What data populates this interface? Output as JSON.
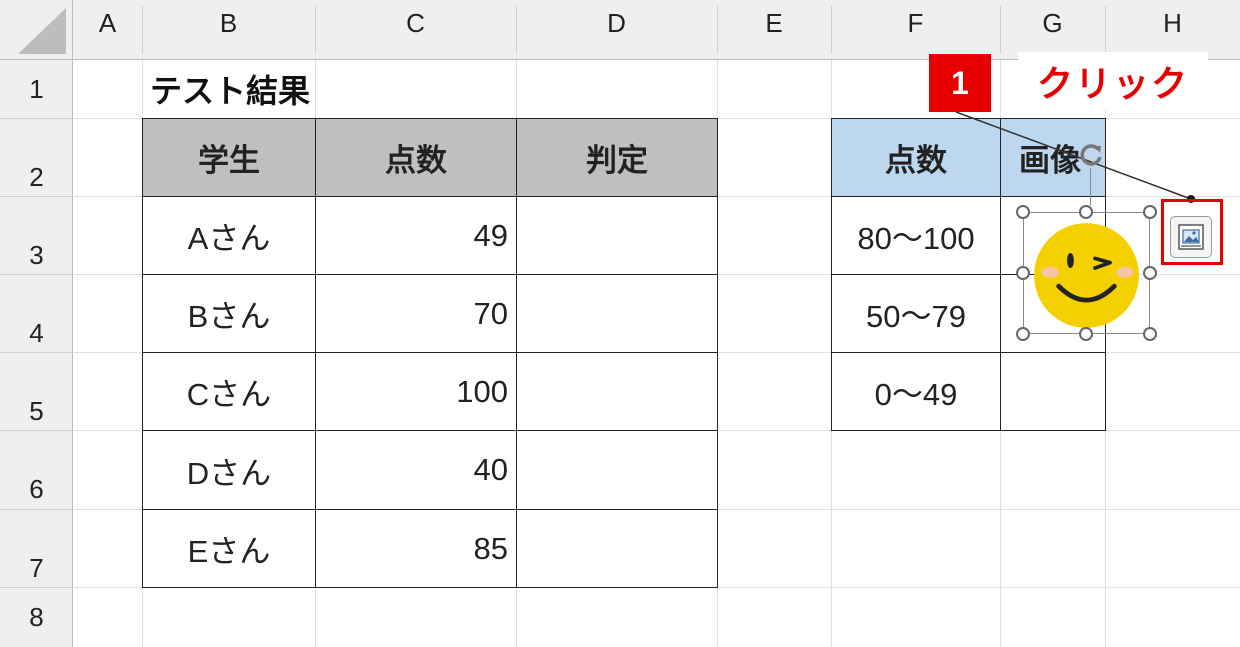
{
  "columns": [
    "A",
    "B",
    "C",
    "D",
    "E",
    "F",
    "G",
    "H"
  ],
  "rows": [
    "1",
    "2",
    "3",
    "4",
    "5",
    "6",
    "7",
    "8"
  ],
  "title": "テスト結果",
  "results_table": {
    "headers": [
      "学生",
      "点数",
      "判定"
    ],
    "rows": [
      {
        "student": "Aさん",
        "score": "49",
        "judgment": ""
      },
      {
        "student": "Bさん",
        "score": "70",
        "judgment": ""
      },
      {
        "student": "Cさん",
        "score": "100",
        "judgment": ""
      },
      {
        "student": "Dさん",
        "score": "40",
        "judgment": ""
      },
      {
        "student": "Eさん",
        "score": "85",
        "judgment": ""
      }
    ]
  },
  "lookup_table": {
    "headers": [
      "点数",
      "画像"
    ],
    "rows": [
      {
        "range": "80～100",
        "image": "smiley-wink"
      },
      {
        "range": "50～79",
        "image": ""
      },
      {
        "range": "0～49",
        "image": ""
      }
    ]
  },
  "annotation": {
    "step_number": "1",
    "instruction": "クリック"
  },
  "icons": {
    "quick_button": "picture-in-cell-icon",
    "rotate": "rotate-handle-icon",
    "picture": "smiley-wink"
  },
  "colors": {
    "header_gray": "#bfbfbf",
    "header_blue": "#bdd7ee",
    "annotation_red": "#e60000",
    "smiley_yellow": "#f5d000"
  }
}
